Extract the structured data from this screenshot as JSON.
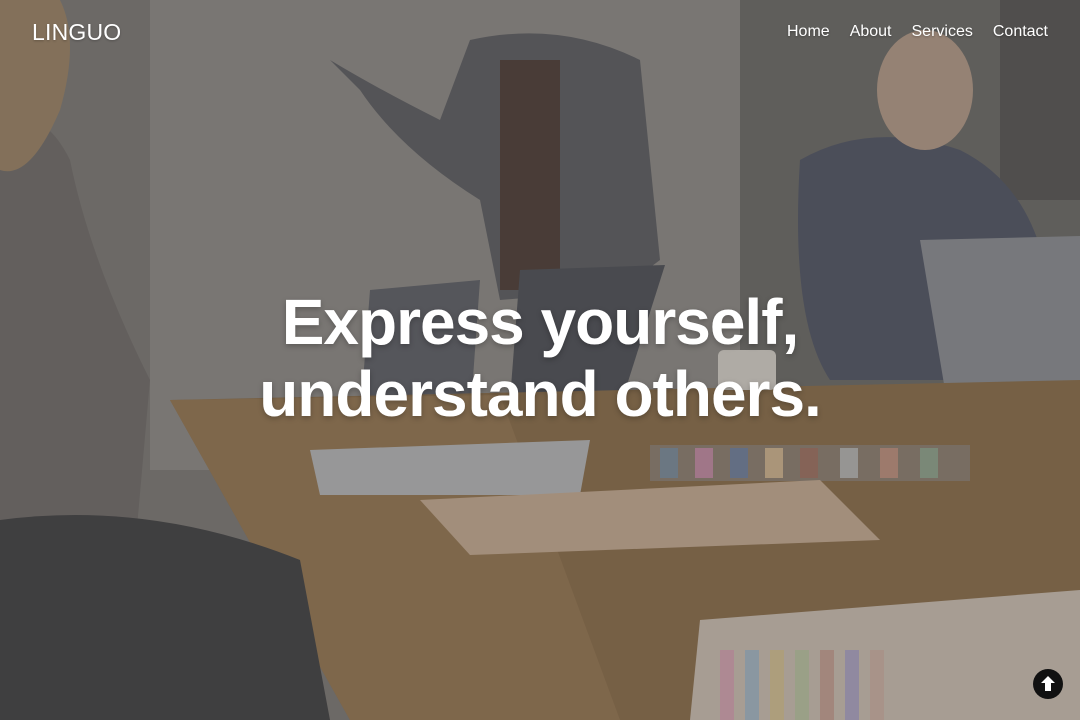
{
  "brand": {
    "name": "LINGUO"
  },
  "nav": {
    "items": [
      {
        "label": "Home"
      },
      {
        "label": "About"
      },
      {
        "label": "Services"
      },
      {
        "label": "Contact"
      }
    ]
  },
  "hero": {
    "headline_line1": "Express yourself,",
    "headline_line2": "understand others.",
    "background_photo": "team-meeting-office-photo"
  },
  "scroll_top": {
    "icon": "arrow-up-circle-icon"
  },
  "colors": {
    "text": "#ffffff",
    "scroll_button": "#111111"
  }
}
